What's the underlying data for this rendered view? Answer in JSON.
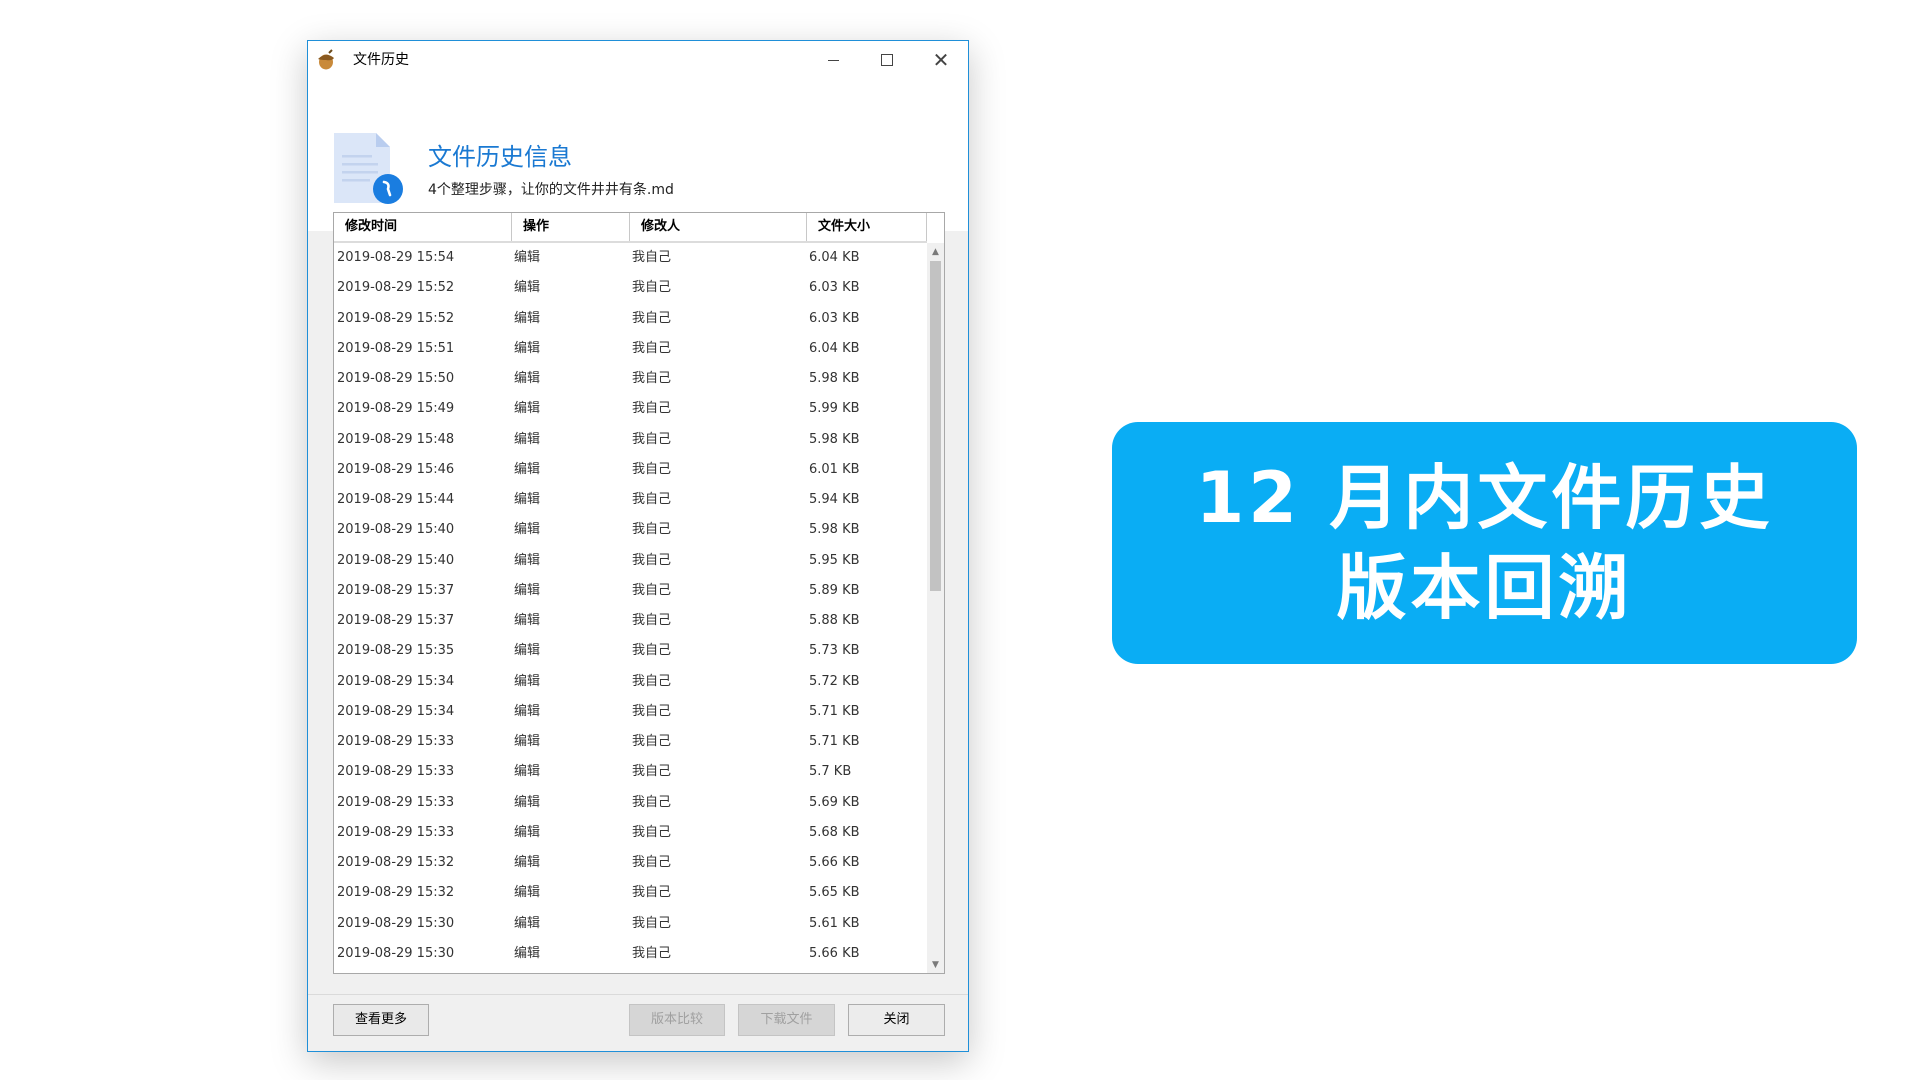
{
  "window": {
    "title": "文件历史",
    "controls": {
      "minimize": "minimize-icon",
      "maximize": "maximize-icon",
      "close": "✕"
    }
  },
  "header": {
    "title": "文件历史信息",
    "file_name": "4个整理步骤，让你的文件井井有条.md",
    "accent_color": "#1a79d2"
  },
  "table": {
    "columns": [
      "修改时间",
      "操作",
      "修改人",
      "文件大小"
    ],
    "rows": [
      [
        "2019-08-29 15:54",
        "编辑",
        "我自己",
        "6.04 KB"
      ],
      [
        "2019-08-29 15:52",
        "编辑",
        "我自己",
        "6.03 KB"
      ],
      [
        "2019-08-29 15:52",
        "编辑",
        "我自己",
        "6.03 KB"
      ],
      [
        "2019-08-29 15:51",
        "编辑",
        "我自己",
        "6.04 KB"
      ],
      [
        "2019-08-29 15:50",
        "编辑",
        "我自己",
        "5.98 KB"
      ],
      [
        "2019-08-29 15:49",
        "编辑",
        "我自己",
        "5.99 KB"
      ],
      [
        "2019-08-29 15:48",
        "编辑",
        "我自己",
        "5.98 KB"
      ],
      [
        "2019-08-29 15:46",
        "编辑",
        "我自己",
        "6.01 KB"
      ],
      [
        "2019-08-29 15:44",
        "编辑",
        "我自己",
        "5.94 KB"
      ],
      [
        "2019-08-29 15:40",
        "编辑",
        "我自己",
        "5.98 KB"
      ],
      [
        "2019-08-29 15:40",
        "编辑",
        "我自己",
        "5.95 KB"
      ],
      [
        "2019-08-29 15:37",
        "编辑",
        "我自己",
        "5.89 KB"
      ],
      [
        "2019-08-29 15:37",
        "编辑",
        "我自己",
        "5.88 KB"
      ],
      [
        "2019-08-29 15:35",
        "编辑",
        "我自己",
        "5.73 KB"
      ],
      [
        "2019-08-29 15:34",
        "编辑",
        "我自己",
        "5.72 KB"
      ],
      [
        "2019-08-29 15:34",
        "编辑",
        "我自己",
        "5.71 KB"
      ],
      [
        "2019-08-29 15:33",
        "编辑",
        "我自己",
        "5.71 KB"
      ],
      [
        "2019-08-29 15:33",
        "编辑",
        "我自己",
        "5.7 KB"
      ],
      [
        "2019-08-29 15:33",
        "编辑",
        "我自己",
        "5.69 KB"
      ],
      [
        "2019-08-29 15:33",
        "编辑",
        "我自己",
        "5.68 KB"
      ],
      [
        "2019-08-29 15:32",
        "编辑",
        "我自己",
        "5.66 KB"
      ],
      [
        "2019-08-29 15:32",
        "编辑",
        "我自己",
        "5.65 KB"
      ],
      [
        "2019-08-29 15:30",
        "编辑",
        "我自己",
        "5.61 KB"
      ],
      [
        "2019-08-29 15:30",
        "编辑",
        "我自己",
        "5.66 KB"
      ]
    ]
  },
  "footer": {
    "more_label": "查看更多",
    "compare_label": "版本比较",
    "download_label": "下载文件",
    "close_label": "关闭"
  },
  "banner": {
    "line1": "12 月内文件历史",
    "line2": "版本回溯",
    "color": "#0aadf4"
  }
}
